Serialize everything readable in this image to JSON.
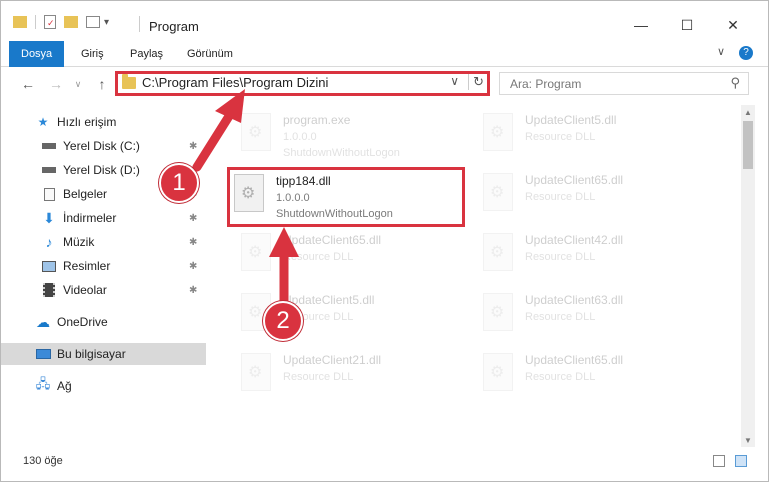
{
  "window": {
    "title": "Program",
    "minimize": "—",
    "maximize": "☐",
    "close": "✕",
    "collapse_ribbon": "∨",
    "help": "?"
  },
  "ribbon": {
    "tabs": [
      "Dosya",
      "Giriş",
      "Paylaş",
      "Görünüm"
    ]
  },
  "address": {
    "path": "C:\\Program Files\\Program Dizini",
    "dropdown": "∨",
    "refresh": "↻"
  },
  "search": {
    "placeholder": "Ara: Program",
    "icon": "⚲"
  },
  "sidebar": {
    "items": [
      {
        "label": "Hızlı erişim",
        "icon": "star-icon"
      },
      {
        "label": "Yerel Disk (C:)",
        "icon": "drive-icon"
      },
      {
        "label": "Yerel Disk (D:)",
        "icon": "drive-icon"
      },
      {
        "label": "Belgeler",
        "icon": "documents-icon"
      },
      {
        "label": "İndirmeler",
        "icon": "download-icon"
      },
      {
        "label": "Müzik",
        "icon": "music-icon"
      },
      {
        "label": "Resimler",
        "icon": "pictures-icon"
      },
      {
        "label": "Videolar",
        "icon": "video-icon"
      },
      {
        "label": "OneDrive",
        "icon": "cloud-icon"
      },
      {
        "label": "Bu bilgisayar",
        "icon": "computer-icon"
      },
      {
        "label": "Ağ",
        "icon": "network-icon"
      }
    ]
  },
  "files": {
    "program": {
      "name": "program.exe",
      "l2": "1.0.0.0",
      "l3": "ShutdownWithoutLogon"
    },
    "tipp": {
      "name": "tipp184.dll",
      "l2": "1.0.0.0",
      "l3": "ShutdownWithoutLogon"
    },
    "left_col": [
      {
        "name": "UpdateClient65.dll",
        "l2": "Resource DLL"
      },
      {
        "name": "UpdateClient5.dll",
        "l2": "Resource DLL"
      },
      {
        "name": "UpdateClient21.dll",
        "l2": "Resource DLL"
      }
    ],
    "right_col": [
      {
        "name": "UpdateClient5.dll",
        "l2": "Resource DLL"
      },
      {
        "name": "UpdateClient65.dll",
        "l2": "Resource DLL"
      },
      {
        "name": "UpdateClient42.dll",
        "l2": "Resource DLL"
      },
      {
        "name": "UpdateClient63.dll",
        "l2": "Resource DLL"
      },
      {
        "name": "UpdateClient65.dll",
        "l2": "Resource DLL"
      }
    ]
  },
  "status": {
    "count": "130 öğe"
  },
  "annotations": {
    "step1": "1",
    "step2": "2",
    "color": "#d9333f"
  }
}
